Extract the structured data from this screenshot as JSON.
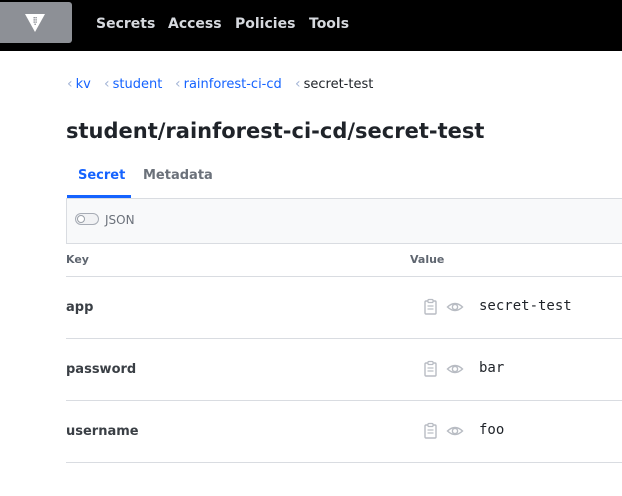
{
  "nav": {
    "logo_icon": "vault-logo-icon",
    "items": [
      {
        "label": "Secrets"
      },
      {
        "label": "Access"
      },
      {
        "label": "Policies"
      },
      {
        "label": "Tools"
      }
    ]
  },
  "breadcrumb": [
    {
      "label": "kv"
    },
    {
      "label": "student"
    },
    {
      "label": "rainforest-ci-cd"
    },
    {
      "label": "secret-test"
    }
  ],
  "page": {
    "title": "student/rainforest-ci-cd/secret-test"
  },
  "tabs": [
    {
      "label": "Secret",
      "active": true
    },
    {
      "label": "Metadata",
      "active": false
    }
  ],
  "toolbar": {
    "json_label": "JSON",
    "json_enabled": false
  },
  "table": {
    "headers": {
      "key": "Key",
      "value": "Value"
    },
    "rows": [
      {
        "key": "app",
        "value": "secret-test"
      },
      {
        "key": "password",
        "value": "bar"
      },
      {
        "key": "username",
        "value": "foo"
      }
    ]
  },
  "colors": {
    "accent": "#1563ff",
    "navbar": "#000000",
    "logo_bg": "#8d9096"
  }
}
